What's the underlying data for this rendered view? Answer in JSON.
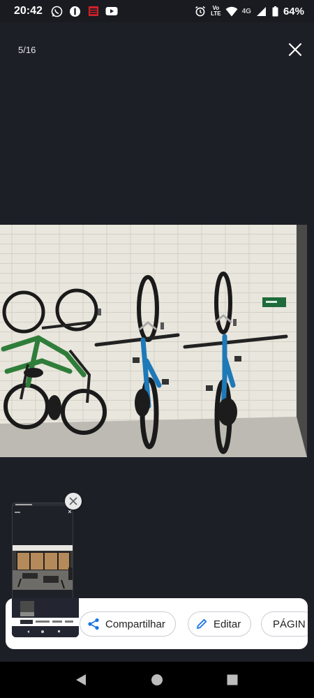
{
  "status_bar": {
    "time": "20:42",
    "left_icons": [
      "whatsapp-icon",
      "notification-icon",
      "app-icon",
      "youtube-icon"
    ],
    "right_icons": [
      "alarm-icon",
      "volte-icon",
      "wifi-icon",
      "signal-icon",
      "battery-icon"
    ],
    "volte_top": "Vo",
    "volte_bottom": "LTE",
    "network": "4G",
    "battery": "64%"
  },
  "viewer": {
    "counter": "5/16",
    "close_icon": "close-icon"
  },
  "preview": {
    "dismiss_icon": "close-icon"
  },
  "actions": [
    {
      "label": "Compartilhar",
      "icon": "share-icon"
    },
    {
      "label": "Editar",
      "icon": "pencil-icon"
    },
    {
      "label": "PÁGIN",
      "icon": ""
    }
  ],
  "nav": {
    "back_icon": "back-triangle-icon",
    "home_icon": "home-circle-icon",
    "recents_icon": "recents-square-icon"
  },
  "colors": {
    "background": "#1c1f26",
    "accent": "#1a73e8",
    "chip_border": "#c9cdd3"
  }
}
